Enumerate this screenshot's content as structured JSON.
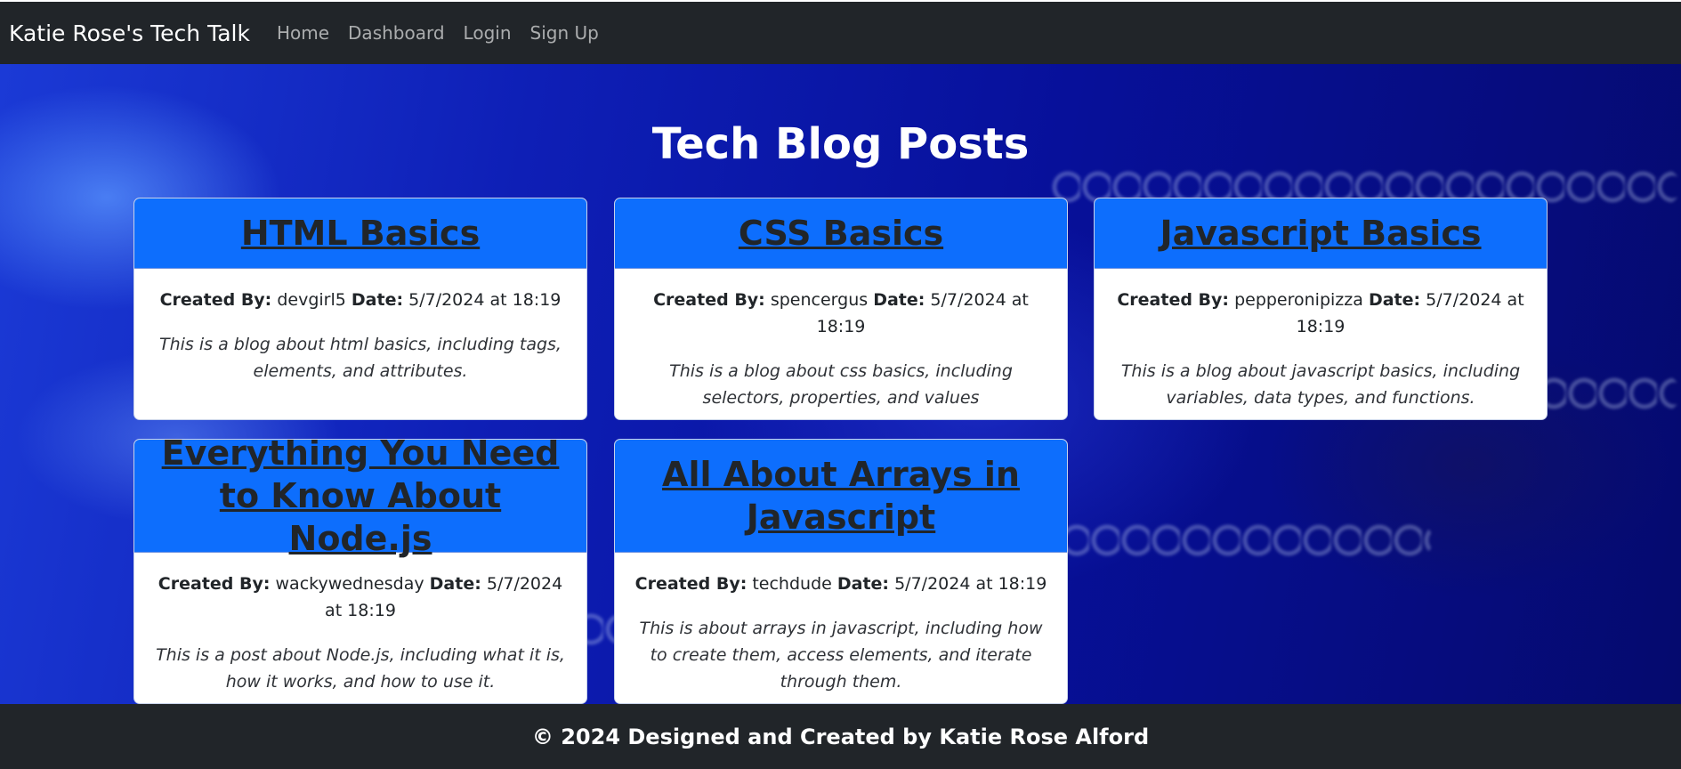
{
  "navbar": {
    "brand": "Katie Rose's Tech Talk",
    "links": [
      "Home",
      "Dashboard",
      "Login",
      "Sign Up"
    ]
  },
  "main": {
    "title": "Tech Blog Posts",
    "meta_labels": {
      "created_by": "Created By:",
      "date": "Date:"
    },
    "posts": [
      {
        "title": "HTML Basics",
        "author": "devgirl5",
        "date": "5/7/2024 at 18:19",
        "description": "This is a blog about html basics, including tags, elements, and attributes."
      },
      {
        "title": "CSS Basics",
        "author": "spencergus",
        "date": "5/7/2024 at 18:19",
        "description": "This is a blog about css basics, including selectors, properties, and values"
      },
      {
        "title": "Javascript Basics",
        "author": "pepperonipizza",
        "date": "5/7/2024 at 18:19",
        "description": "This is a blog about javascript basics, including variables, data types, and functions."
      },
      {
        "title": "Everything You Need to Know About Node.js",
        "author": "wackywednesday",
        "date": "5/7/2024 at 18:19",
        "description": "This is a post about Node.js, including what it is, how it works, and how to use it."
      },
      {
        "title": "All About Arrays in Javascript",
        "author": "techdude",
        "date": "5/7/2024 at 18:19",
        "description": "This is about arrays in javascript, including how to create them, access elements, and iterate through them."
      }
    ]
  },
  "footer": {
    "text": "© 2024 Designed and Created by Katie Rose Alford"
  },
  "colors": {
    "navbar_bg": "#212529",
    "card_header": "#0d6efd",
    "text_dark": "#212529",
    "hero_blue": "#0e1fb6"
  }
}
